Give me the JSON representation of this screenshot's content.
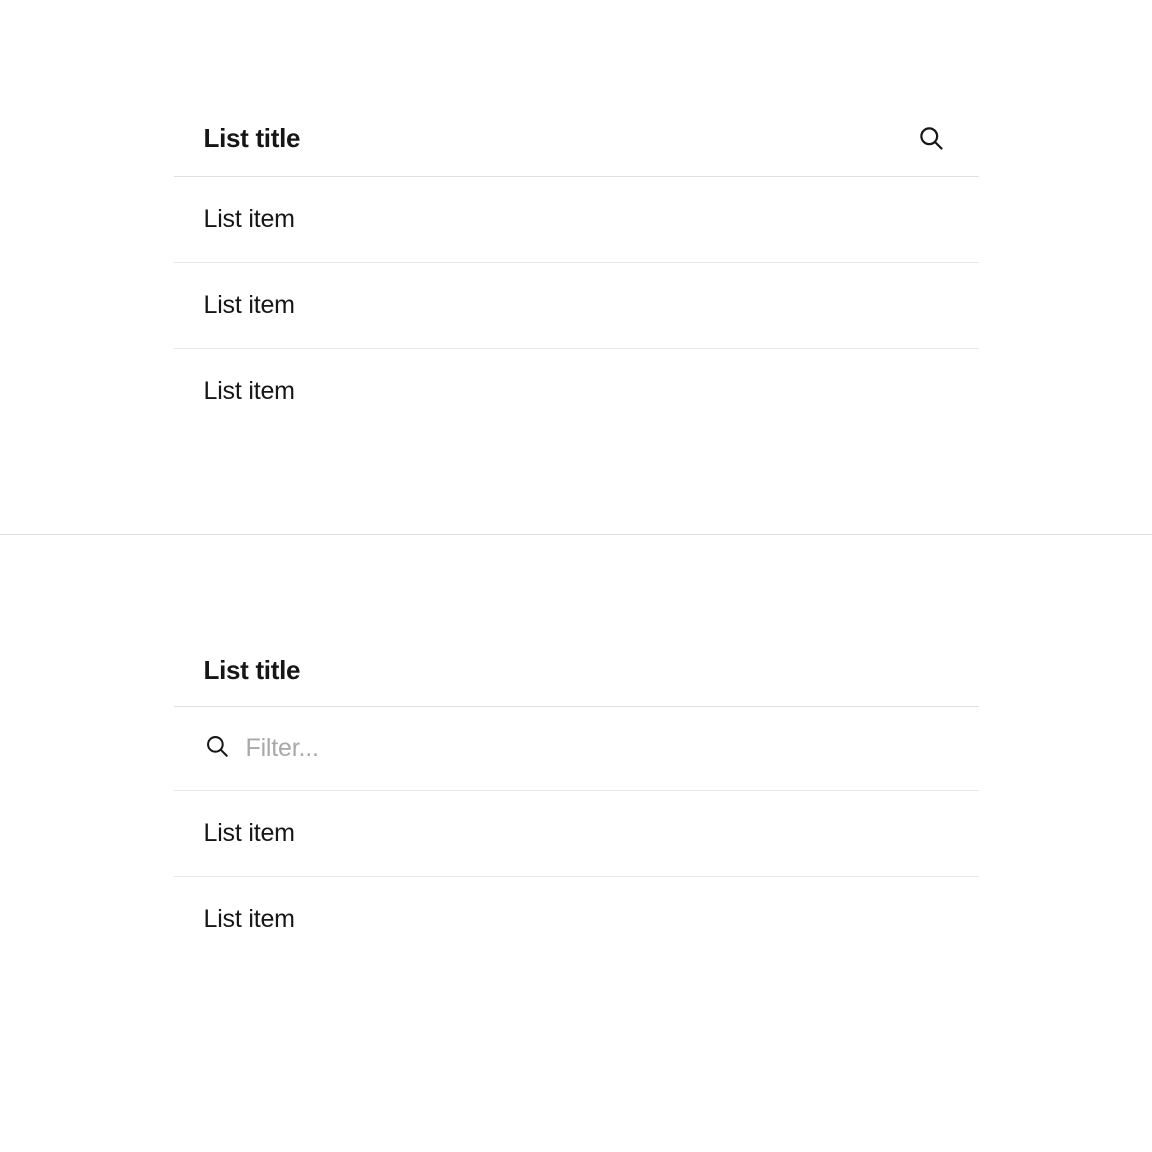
{
  "section1": {
    "title": "List title",
    "items": [
      {
        "label": "List item"
      },
      {
        "label": "List item"
      },
      {
        "label": "List item"
      }
    ]
  },
  "section2": {
    "title": "List title",
    "filter_placeholder": "Filter...",
    "items": [
      {
        "label": "List item"
      },
      {
        "label": "List item"
      }
    ]
  }
}
